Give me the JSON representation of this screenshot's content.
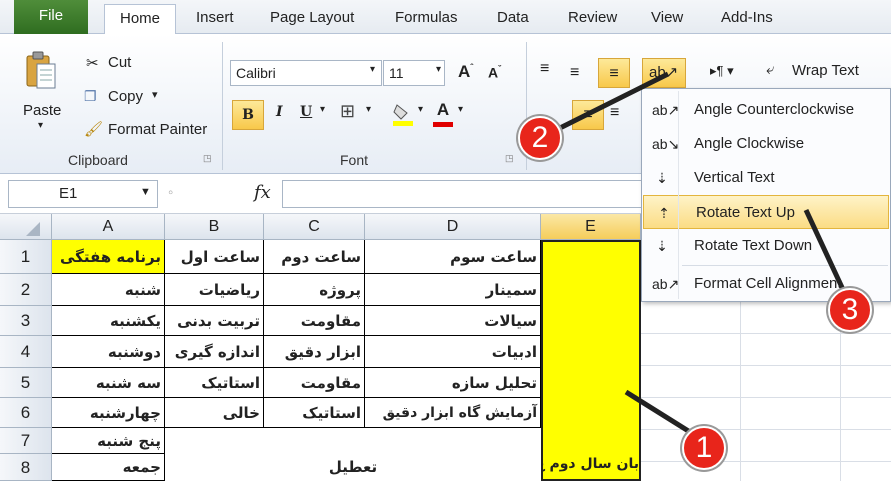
{
  "tabs": {
    "file": "File",
    "home": "Home",
    "insert": "Insert",
    "page_layout": "Page Layout",
    "formulas": "Formulas",
    "data": "Data",
    "review": "Review",
    "view": "View",
    "addins": "Add-Ins"
  },
  "clipboard": {
    "paste": "Paste",
    "cut": "Cut",
    "copy": "Copy",
    "copy_arrow": "▾",
    "format_painter": "Format Painter",
    "group": "Clipboard"
  },
  "font": {
    "name": "Calibri",
    "size": "11",
    "group": "Font",
    "bold": "B",
    "italic": "I",
    "underline": "U"
  },
  "alignment": {
    "wrap_text": "Wrap Text"
  },
  "formula_bar": {
    "name_box": "E1",
    "fx": "fx",
    "value": ""
  },
  "columns": [
    "A",
    "B",
    "C",
    "D",
    "E"
  ],
  "rows": [
    "1",
    "2",
    "3",
    "4",
    "5",
    "6",
    "7",
    "8"
  ],
  "cells": {
    "r1": [
      "برنامه هفتگی",
      "ساعت اول",
      "ساعت دوم",
      "ساعت سوم"
    ],
    "r2": [
      "شنبه",
      "ریاضیات",
      "پروژه",
      "سمینار"
    ],
    "r3": [
      "یکشنبه",
      "تربیت بدنی",
      "مقاومت",
      "سیالات"
    ],
    "r4": [
      "دوشنبه",
      "اندازه گیری",
      "ابزار دقیق",
      "ادبیات"
    ],
    "r5": [
      "سه شنبه",
      "استاتیک",
      "مقاومت",
      "تحلیل سازه"
    ],
    "r6": [
      "چهارشنبه",
      "خالی",
      "استاتیک",
      "آزمایش گاه ابزار دقیق"
    ],
    "r7": [
      "پنج شنبه",
      "",
      "",
      ""
    ],
    "r8": [
      "جمعه",
      "",
      "تعطیل",
      ""
    ],
    "e8": "بان سال دوم ع"
  },
  "orientation_menu": {
    "items": [
      {
        "label": "Angle Counterclockwise",
        "icon": "angle-ccw-icon"
      },
      {
        "label": "Angle Clockwise",
        "icon": "angle-cw-icon"
      },
      {
        "label": "Vertical Text",
        "icon": "vertical-text-icon"
      },
      {
        "label": "Rotate Text Up",
        "icon": "rotate-up-icon"
      },
      {
        "label": "Rotate Text Down",
        "icon": "rotate-down-icon"
      },
      {
        "label": "Format Cell Alignment",
        "icon": "format-align-icon"
      }
    ]
  },
  "callouts": [
    "1",
    "2",
    "3"
  ],
  "colors": {
    "header_yellow": "#ffff00",
    "file_green": "#3f7e2c",
    "highlight": "#fde58a",
    "badge_red": "#e8251b"
  }
}
